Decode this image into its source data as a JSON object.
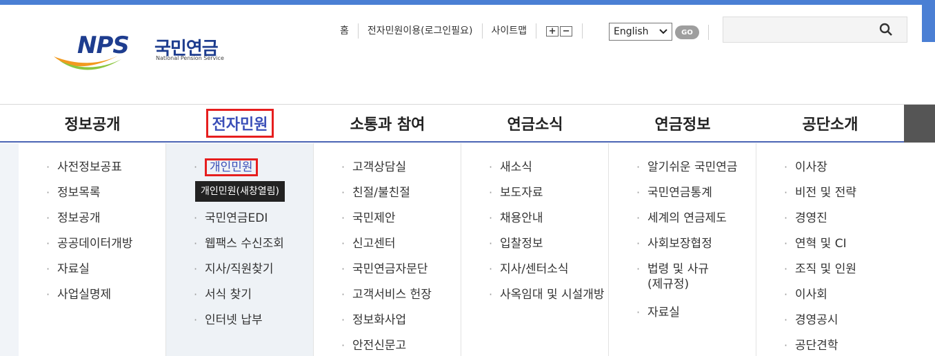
{
  "logo": {
    "abbr": "NPS",
    "name_ko": "국민연금",
    "name_en": "National Pension Service"
  },
  "util_nav": {
    "links": [
      "홈",
      "전자민원이용(로그인필요)",
      "사이트맵"
    ],
    "zoom_in": "+",
    "zoom_out": "−",
    "language": "English",
    "go_label": "GO",
    "search_placeholder": ""
  },
  "gnb": {
    "items": [
      "정보공개",
      "전자민원",
      "소통과 참여",
      "연금소식",
      "연금정보",
      "공단소개"
    ]
  },
  "submenu": {
    "col0": [
      "사전정보공표",
      "정보목록",
      "정보공개",
      "공공데이터개방",
      "자료실",
      "사업실명제"
    ],
    "col1": [
      "개인민원",
      "국민연금EDI",
      "웹팩스 수신조회",
      "지사/직원찾기",
      "서식 찾기",
      "인터넷 납부"
    ],
    "col2": [
      "고객상담실",
      "친절/불친절",
      "국민제안",
      "신고센터",
      "국민연금자문단",
      "고객서비스 헌장",
      "정보화사업",
      "안전신문고"
    ],
    "col3": [
      "새소식",
      "보도자료",
      "채용안내",
      "입찰정보",
      "지사/센터소식",
      "사옥임대 및 시설개방"
    ],
    "col4": [
      "알기쉬운 국민연금",
      "국민연금통계",
      "세계의 연금제도",
      "사회보장협정",
      "법령 및 사규(제규정)",
      "자료실"
    ],
    "col5": [
      "이사장",
      "비전 및 전략",
      "경영진",
      "연혁 및 CI",
      "조직 및 인원",
      "이사회",
      "경영공시",
      "공단견학"
    ]
  },
  "tooltip": "개인민원(새창열림)",
  "colors": {
    "top_bar": "#4a7fd4",
    "active_text": "#3b4fb8",
    "highlight_border": "#e61e1e",
    "gnb_underline": "#4a64b4"
  }
}
